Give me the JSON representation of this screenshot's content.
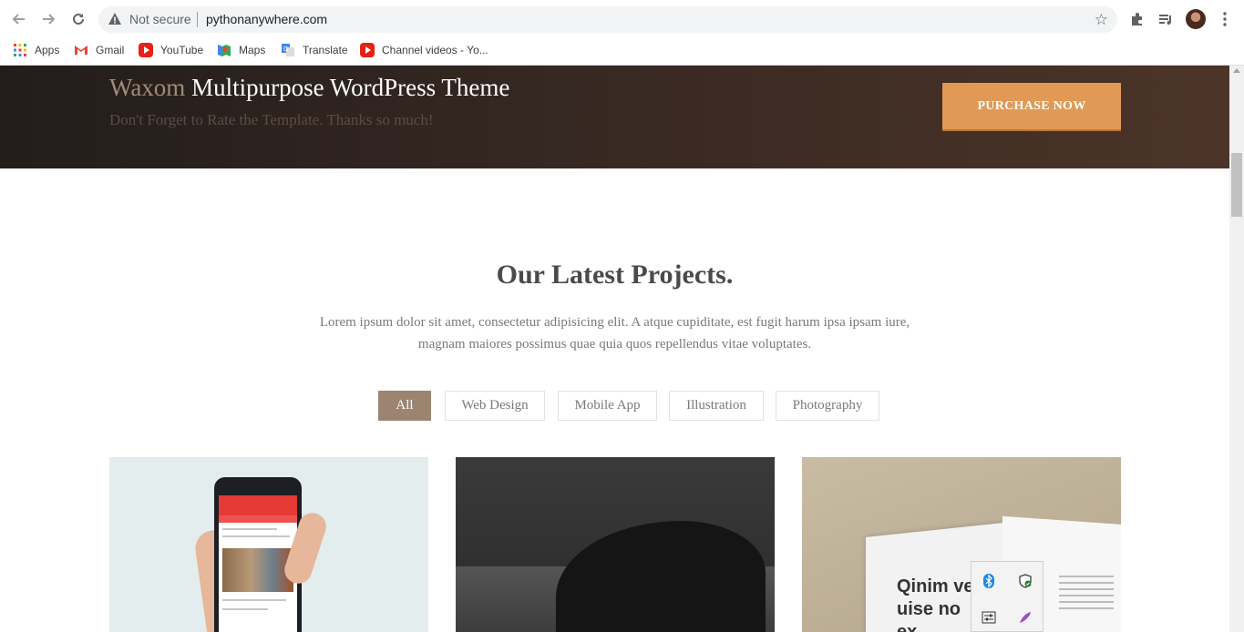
{
  "browser": {
    "security_label": "Not secure",
    "url": "pythonanywhere.com",
    "bookmarks": [
      {
        "label": "Apps",
        "icon": "apps-grid-icon"
      },
      {
        "label": "Gmail",
        "icon": "gmail-icon"
      },
      {
        "label": "YouTube",
        "icon": "youtube-icon"
      },
      {
        "label": "Maps",
        "icon": "maps-icon"
      },
      {
        "label": "Translate",
        "icon": "translate-icon"
      },
      {
        "label": "Channel videos - Yo...",
        "icon": "youtube-icon"
      }
    ]
  },
  "hero": {
    "brand": "Waxom",
    "title": " Multipurpose WordPress Theme",
    "subtitle": "Don't Forget to Rate the Template. Thanks so much!",
    "cta": "PURCHASE NOW"
  },
  "projects": {
    "title": "Our Latest Projects.",
    "description": "Lorem ipsum dolor sit amet, consectetur adipisicing elit. A atque cupiditate, est fugit harum ipsa ipsam iure, magnam maiores possimus quae quia quos repellendus vitae voluptates.",
    "filters": [
      "All",
      "Web Design",
      "Mobile App",
      "Illustration",
      "Photography"
    ],
    "active_filter": "All",
    "card3_text": "Qinim ve\nuise no\nex"
  },
  "colors": {
    "accent": "#e09a55",
    "filter_active": "#9b8571",
    "hero_dark": "#221d1b"
  }
}
